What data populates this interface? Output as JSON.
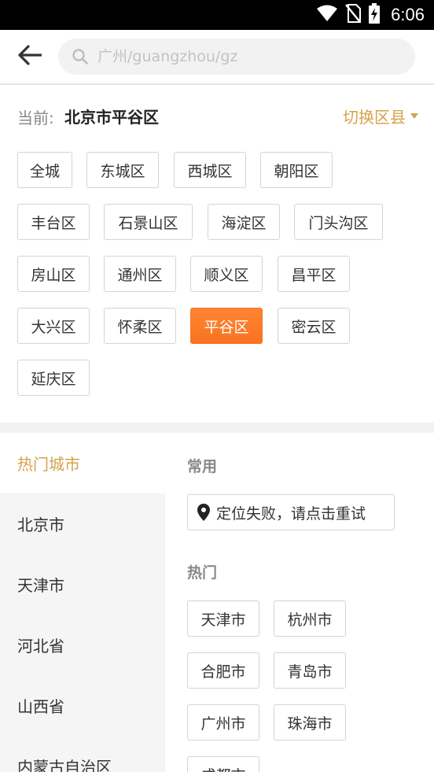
{
  "status_bar": {
    "time": "6:06",
    "icons": [
      "wifi-icon",
      "no-sim-icon",
      "battery-charging-icon"
    ]
  },
  "header": {
    "back_icon": "arrow-left-icon",
    "search_placeholder": "广州/guangzhou/gz",
    "search_icon": "search-icon"
  },
  "current": {
    "label": "当前:",
    "value": "北京市平谷区",
    "switch_label": "切换区县"
  },
  "districts": [
    [
      "全城",
      "东城区",
      "西城区",
      "朝阳区"
    ],
    [
      "丰台区",
      "石景山区",
      "海淀区",
      "门头沟区"
    ],
    [
      "房山区",
      "通州区",
      "顺义区",
      "昌平区"
    ],
    [
      "大兴区",
      "怀柔区",
      "平谷区",
      "密云区"
    ],
    [
      "延庆区"
    ]
  ],
  "active_district": "平谷区",
  "provinces": [
    {
      "label": "热门城市",
      "active": true
    },
    {
      "label": "北京市"
    },
    {
      "label": "天津市"
    },
    {
      "label": "河北省"
    },
    {
      "label": "山西省"
    },
    {
      "label": "内蒙古自治区"
    }
  ],
  "city_pane": {
    "common_title": "常用",
    "locate_label": "定位失败，请点击重试",
    "hot_title": "热门",
    "hot_cities": [
      "天津市",
      "杭州市",
      "合肥市",
      "青岛市",
      "广州市",
      "珠海市",
      "成都市"
    ]
  },
  "colors": {
    "accent": "#d6a24a",
    "active_chip": "#f97320"
  }
}
